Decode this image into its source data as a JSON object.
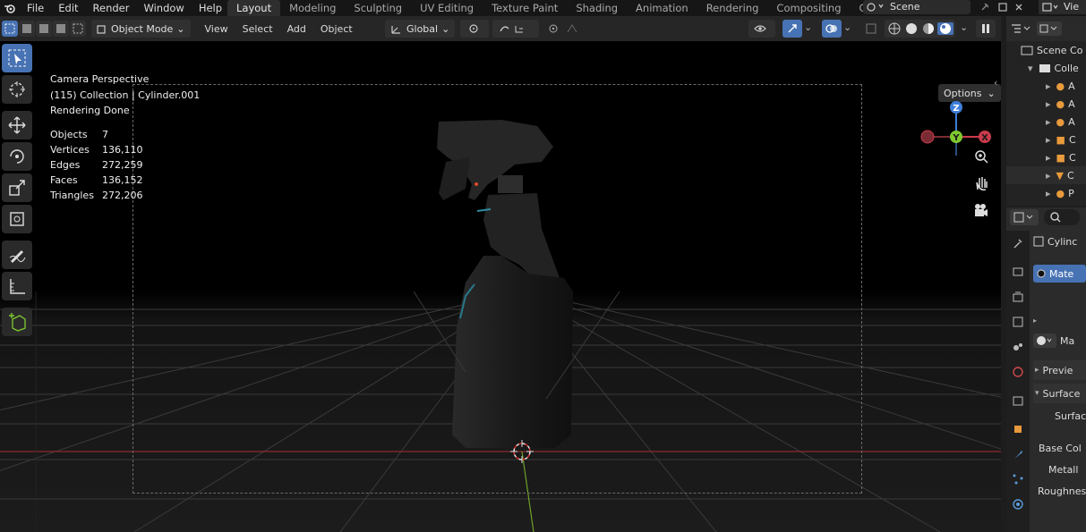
{
  "topbar": {
    "menus": [
      "File",
      "Edit",
      "Render",
      "Window",
      "Help"
    ],
    "workspaces": [
      "Layout",
      "Modeling",
      "Sculpting",
      "UV Editing",
      "Texture Paint",
      "Shading",
      "Animation",
      "Rendering",
      "Compositing",
      "Geomet"
    ],
    "active_workspace": "Layout",
    "scene": "Scene",
    "view_layer": "Vie"
  },
  "viewport_header": {
    "mode": "Object Mode",
    "menus": [
      "View",
      "Select",
      "Add",
      "Object"
    ],
    "transform_orientation": "Global",
    "options_label": "Options"
  },
  "viewport": {
    "camera_label": "Camera Perspective",
    "collection_label": "(115) Collection | Cylinder.001",
    "status_label": "Rendering Done",
    "stats": [
      {
        "key": "Objects",
        "value": "7"
      },
      {
        "key": "Vertices",
        "value": "136,110"
      },
      {
        "key": "Edges",
        "value": "272,259"
      },
      {
        "key": "Faces",
        "value": "136,152"
      },
      {
        "key": "Triangles",
        "value": "272,206"
      }
    ],
    "gizmo": {
      "z": "Z",
      "y": "Y",
      "x": "X"
    }
  },
  "outliner": {
    "scene_collection": "Scene Co",
    "collection": "Colle",
    "items": [
      "A",
      "A",
      "A",
      "C",
      "C",
      "C",
      "P"
    ]
  },
  "properties": {
    "object_name": "Cylinc",
    "material_slot": "Mate",
    "material_field": "Ma",
    "sections": [
      "Previe",
      "Surface"
    ],
    "fields": [
      "Surfac",
      "Base Col",
      "Metall",
      "Roughnes"
    ]
  },
  "colors": {
    "accent": "#4772b3",
    "axis_x": "#cc3b4c",
    "axis_y": "#7fc92f",
    "axis_z": "#3d7ed9"
  }
}
